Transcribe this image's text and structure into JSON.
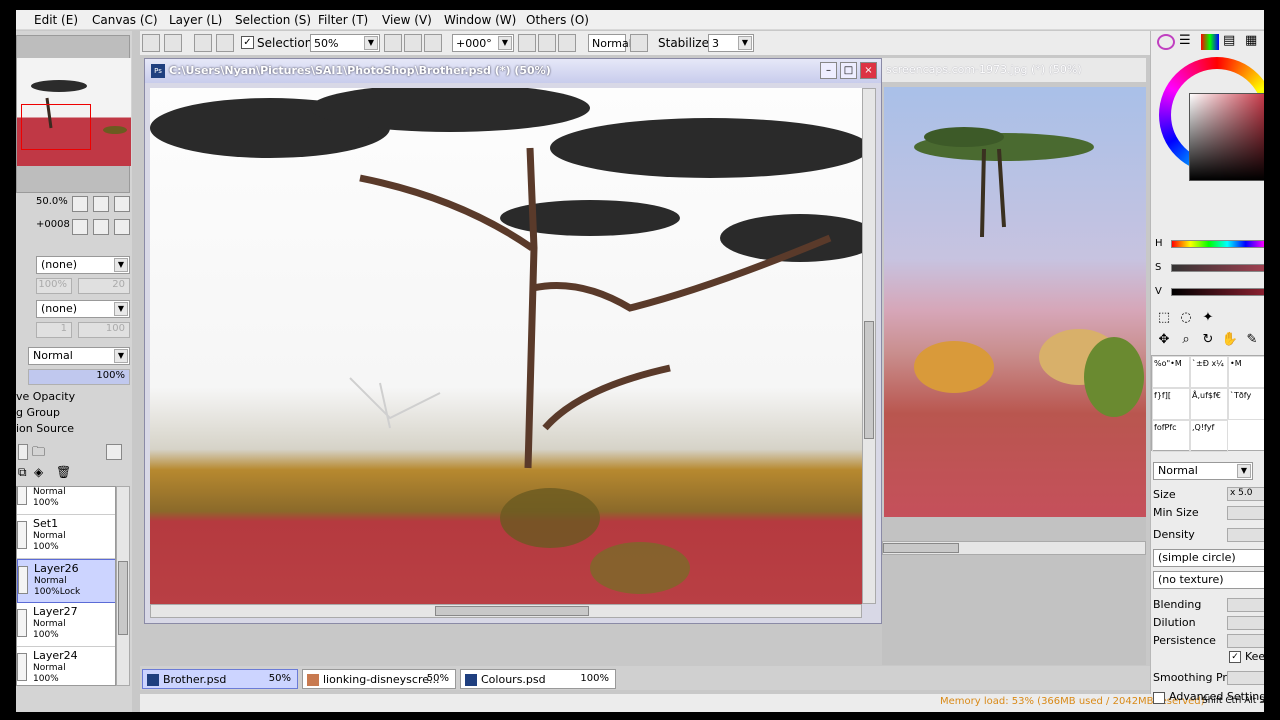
{
  "menu": [
    "Edit (E)",
    "Canvas (C)",
    "Layer (L)",
    "Selection (S)",
    "Filter (T)",
    "View (V)",
    "Window (W)",
    "Others (O)"
  ],
  "left_panel": {
    "zoom": "50.0%",
    "angle": "+0008",
    "texture_a": "(none)",
    "texture_a_pct": "100%",
    "texture_a_val": "20",
    "texture_b": "(none)",
    "texture_b_val1": "1",
    "texture_b_val2": "100",
    "blend_mode": "Normal",
    "opacity": "100%",
    "options": [
      "ve Opacity",
      "g Group",
      "ion Source"
    ],
    "layers": [
      {
        "name": "",
        "mode": "Normal",
        "opacity": "100%"
      },
      {
        "name": "Set1",
        "mode": "Normal",
        "opacity": "100%"
      },
      {
        "name": "Layer26",
        "mode": "Normal",
        "opacity": "100%Lock"
      },
      {
        "name": "Layer27",
        "mode": "Normal",
        "opacity": "100%"
      },
      {
        "name": "Layer24",
        "mode": "Normal",
        "opacity": "100%"
      }
    ]
  },
  "toolbar": {
    "selection_label": "Selection",
    "zoom": "50%",
    "angle": "+000°",
    "blend": "Normal",
    "stabilizer_label": "Stabilizer",
    "stabilizer_value": "3"
  },
  "document": {
    "title": "C:\\Users\\Nyan\\Pictures\\SAI1\\PhotoShop\\Brother.psd (*) (50%)",
    "minimize": "–",
    "maximize": "□",
    "close": "×"
  },
  "reference_window": {
    "title": "screencaps.com-1973.jpg (*) (50%)"
  },
  "tabs": [
    {
      "name": "Brother.psd",
      "zoom": "50%",
      "active": true
    },
    {
      "name": "lionking-disneyscre...",
      "zoom": "50%",
      "active": false
    },
    {
      "name": "Colours.psd",
      "zoom": "100%",
      "active": false
    }
  ],
  "status": {
    "memory": "Memory load: 53% (366MB used / 2042MB reserved)",
    "keys": "Shift Ctrl Alt Sp"
  },
  "right_panel": {
    "sliders": [
      "H",
      "S",
      "V"
    ],
    "brush_cells": [
      "%o\"•M",
      "`±Ð x¼",
      "•M",
      "f}f][",
      "Å,uf$f€",
      "`Tðfy",
      "fofPfc",
      ",Q!fyf"
    ],
    "blend": "Normal",
    "size_label": "Size",
    "size_mult": "x 5.0",
    "min_size_label": "Min Size",
    "density_label": "Density",
    "shape": "(simple circle)",
    "texture": "(no texture)",
    "blending_label": "Blending",
    "dilution_label": "Dilution",
    "persistence_label": "Persistence",
    "keep_label": "Keep",
    "smoothing_label": "Smoothing Prs",
    "advanced_label": "Advanced Settings"
  },
  "colors": {
    "accent": "#5b6bd6",
    "ground_red": "#b93f44",
    "status_orange": "#d98a18"
  }
}
